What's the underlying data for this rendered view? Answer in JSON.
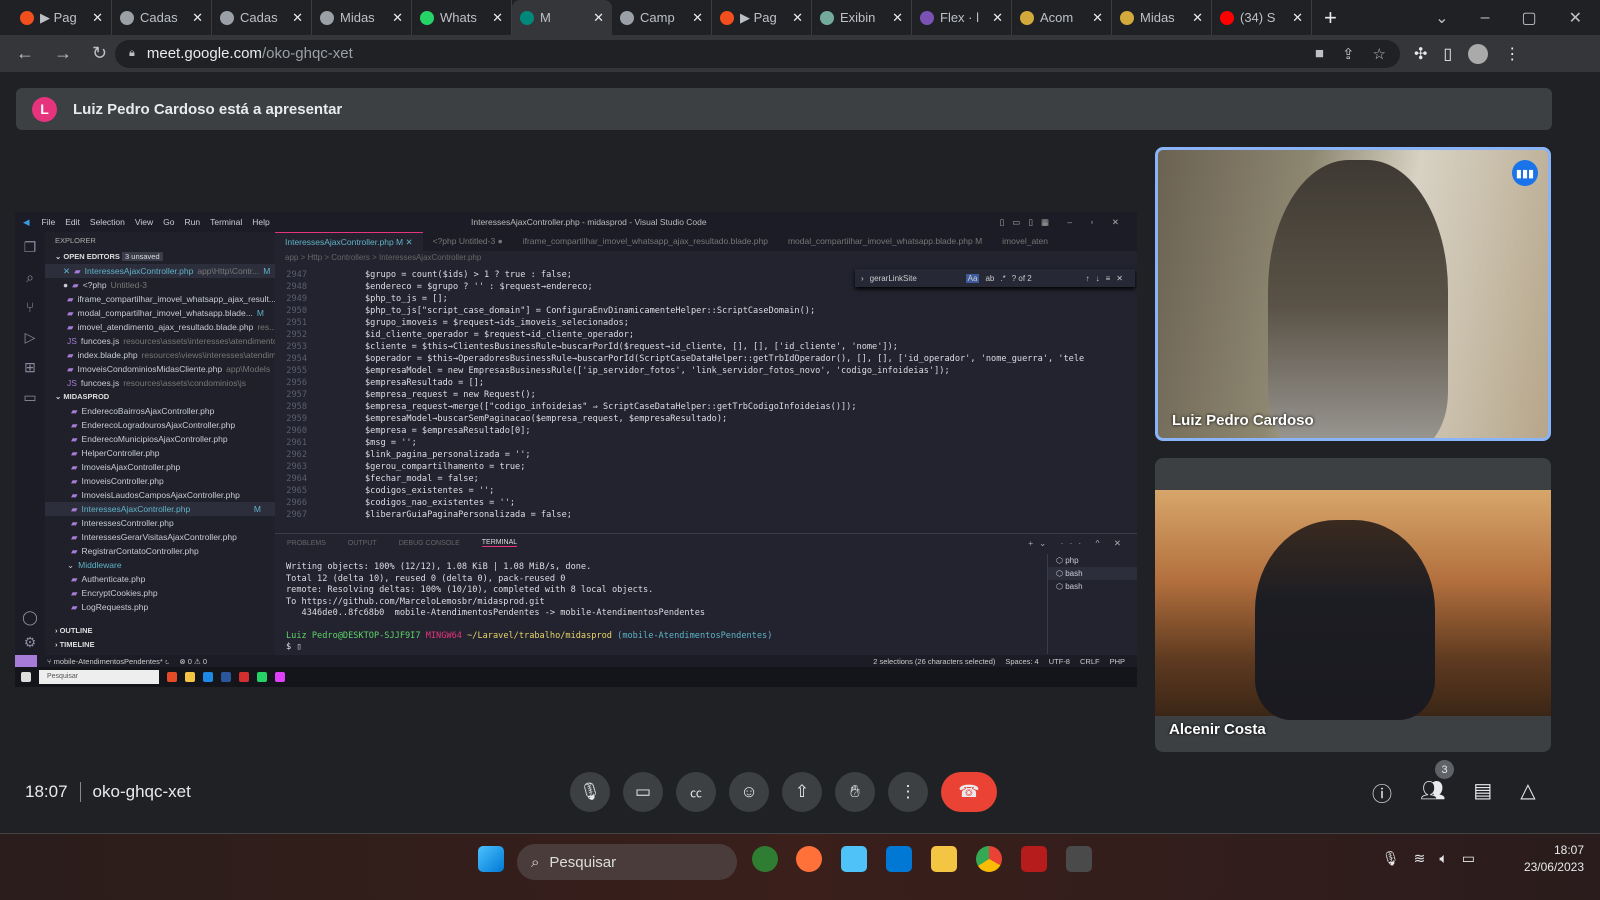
{
  "browser": {
    "tabs": [
      {
        "label": "▶ Pag",
        "color": "#f24e1e"
      },
      {
        "label": "Cadas",
        "color": "#9aa0a6"
      },
      {
        "label": "Cadas",
        "color": "#9aa0a6"
      },
      {
        "label": "Midas",
        "color": "#9aa0a6"
      },
      {
        "label": "Whats",
        "color": "#25d366"
      },
      {
        "label": "M",
        "color": "#00897b",
        "active": true
      },
      {
        "label": "Camp",
        "color": "#9aa0a6"
      },
      {
        "label": "▶ Pag",
        "color": "#f24e1e"
      },
      {
        "label": "Exibin",
        "color": "#74aa9c"
      },
      {
        "label": "Flex · l",
        "color": "#7952b3"
      },
      {
        "label": "Acom",
        "color": "#d4a93c"
      },
      {
        "label": "Midas",
        "color": "#d4a93c"
      },
      {
        "label": "(34) S",
        "color": "#ff0000"
      }
    ],
    "new_tab": "+",
    "url_domain": "meet.google.com",
    "url_path": "/oko-ghqc-xet"
  },
  "meet": {
    "banner_initial": "L",
    "banner_text": "Luiz Pedro Cardoso está a apresentar",
    "participants": [
      {
        "name": "Luiz Pedro Cardoso",
        "speaking": true
      },
      {
        "name": "Alcenir Costa"
      }
    ],
    "time": "18:07",
    "meeting_code": "oko-ghqc-xet",
    "participant_count": "3",
    "accent": "#8ab4f8",
    "end_color": "#ea4335"
  },
  "vscode": {
    "menu": [
      "File",
      "Edit",
      "Selection",
      "View",
      "Go",
      "Run",
      "Terminal",
      "Help"
    ],
    "title": "InteressesAjaxController.php - midasprod - Visual Studio Code",
    "explorer_label": "EXPLORER",
    "open_editors_label": "OPEN EDITORS",
    "unsaved": "3 unsaved",
    "open_editors": [
      {
        "name": "InteressesAjaxController.php",
        "path": "app\\Http\\Contr...",
        "mark": "M",
        "sel": true,
        "prefix": "✕"
      },
      {
        "name": "<?php",
        "path": "Untitled-3",
        "prefix": "●"
      },
      {
        "name": "iframe_compartilhar_imovel_whatsapp_ajax_result..."
      },
      {
        "name": "modal_compartilhar_imovel_whatsapp.blade...",
        "mark": "M"
      },
      {
        "name": "imovel_atendimento_ajax_resultado.blade.php",
        "path": "res..."
      },
      {
        "name": "funcoes.js",
        "path": "resources\\assets\\interesses\\atendimento\\js"
      },
      {
        "name": "index.blade.php",
        "path": "resources\\views\\interesses\\atendime..."
      },
      {
        "name": "ImoveisCondominiosMidasCliente.php",
        "path": "app\\Models"
      },
      {
        "name": "funcoes.js",
        "path": "resources\\assets\\condominios\\js"
      }
    ],
    "project_label": "MIDASPROD",
    "project_files": [
      {
        "name": "EnderecoBairrosAjaxController.php"
      },
      {
        "name": "EnderecoLogradourosAjaxController.php"
      },
      {
        "name": "EnderecoMunicipiosAjaxController.php"
      },
      {
        "name": "HelperController.php"
      },
      {
        "name": "ImoveisAjaxController.php"
      },
      {
        "name": "ImoveisController.php"
      },
      {
        "name": "ImoveisLaudosCamposAjaxController.php"
      },
      {
        "name": "InteressesAjaxController.php",
        "mark": "M",
        "sel": true
      },
      {
        "name": "InteressesController.php"
      },
      {
        "name": "InteressesGerarVisitasAjaxController.php"
      },
      {
        "name": "RegistrarContatoController.php"
      },
      {
        "name": "Middleware",
        "folder": true
      },
      {
        "name": "Authenticate.php"
      },
      {
        "name": "EncryptCookies.php"
      },
      {
        "name": "LogRequests.php"
      }
    ],
    "outline_label": "OUTLINE",
    "timeline_label": "TIMELINE",
    "editor_tabs": [
      {
        "label": "InteressesAjaxController.php M ✕",
        "active": true
      },
      {
        "label": "<?php Untitled-3 ●"
      },
      {
        "label": "iframe_compartilhar_imovel_whatsapp_ajax_resultado.blade.php"
      },
      {
        "label": "modal_compartilhar_imovel_whatsapp.blade.php M"
      },
      {
        "label": "imovel_aten"
      }
    ],
    "breadcrumb": "app > Http > Controllers > InteressesAjaxController.php",
    "find": {
      "query": "gerarLinkSite",
      "options": [
        "Aa",
        "ab",
        ".*"
      ],
      "count": "? of 2"
    },
    "code_lines": [
      {
        "n": "2947",
        "t": "$grupo = count($ids) > 1 ? true : false;"
      },
      {
        "n": "2948",
        "t": "$endereco = $grupo ? '' : $request→endereco;"
      },
      {
        "n": "2949",
        "t": "$php_to_js = [];"
      },
      {
        "n": "2950",
        "t": "$php_to_js[\"script_case_domain\"] = ConfiguraEnvDinamicamenteHelper::ScriptCaseDomain();"
      },
      {
        "n": "2951",
        "t": "$grupo_imoveis = $request→ids_imoveis_selecionados;"
      },
      {
        "n": "2952",
        "t": "$id_cliente_operador = $request→id_cliente_operador;"
      },
      {
        "n": "2953",
        "t": "$cliente = $this→ClientesBusinessRule→buscarPorId($request→id_cliente, [], [], ['id_cliente', 'nome']);"
      },
      {
        "n": "2954",
        "t": "$operador = $this→OperadoresBusinessRule→buscarPorId(ScriptCaseDataHelper::getTrbIdOperador(), [], [], ['id_operador', 'nome_guerra', 'tele"
      },
      {
        "n": "2955",
        "t": "$empresaModel = new EmpresasBusinessRule(['ip_servidor_fotos', 'link_servidor_fotos_novo', 'codigo_infoideias']);"
      },
      {
        "n": "2956",
        "t": "$empresaResultado = [];"
      },
      {
        "n": "2957",
        "t": "$empresa_request = new Request();"
      },
      {
        "n": "2958",
        "t": "$empresa_request→merge([\"codigo_infoideias\" ⇒ ScriptCaseDataHelper::getTrbCodigoInfoideias()]);"
      },
      {
        "n": "2959",
        "t": "$empresaModel→buscarSemPaginacao($empresa_request, $empresaResultado);"
      },
      {
        "n": "2960",
        "t": "$empresa = $empresaResultado[0];"
      },
      {
        "n": "2961",
        "t": "$msg = '';"
      },
      {
        "n": "2962",
        "t": "$link_pagina_personalizada = '';"
      },
      {
        "n": "2963",
        "t": "$gerou_compartilhamento = true;"
      },
      {
        "n": "2964",
        "t": "$fechar_modal = false;"
      },
      {
        "n": "2965",
        "t": "$codigos_existentes = '';"
      },
      {
        "n": "2966",
        "t": "$codigos_nao_existentes = '';"
      },
      {
        "n": "2967",
        "t": "$liberarGuiaPaginaPersonalizada = false;"
      }
    ],
    "panel_tabs": [
      "PROBLEMS",
      "OUTPUT",
      "DEBUG CONSOLE",
      "TERMINAL"
    ],
    "terminal_lines": [
      "Writing objects: 100% (12/12), 1.08 KiB | 1.08 MiB/s, done.",
      "Total 12 (delta 10), reused 0 (delta 0), pack-reused 0",
      "remote: Resolving deltas: 100% (10/10), completed with 8 local objects.",
      "To https://github.com/MarceloLemosbr/midasprod.git",
      "   4346de0..8fc68b0  mobile-AtendimentosPendentes -> mobile-AtendimentosPendentes"
    ],
    "prompt": {
      "user": "Luiz Pedro@DESKTOP-SJJF9I7",
      "env": "MINGW64",
      "path": "~/Laravel/trabalho/midasprod",
      "branch": "(mobile-AtendimentosPendentes)",
      "cursor": "$"
    },
    "terminals": [
      "php",
      "bash",
      "bash"
    ],
    "status": {
      "branch": "mobile-AtendimentosPendentes*",
      "problems": "⊗ 0 ⚠ 0",
      "selection": "2 selections (26 characters selected)",
      "spaces": "Spaces: 4",
      "encoding": "UTF-8",
      "eol": "CRLF",
      "lang": "PHP"
    },
    "inner_search": "Pesquisar"
  },
  "taskbar": {
    "search": "Pesquisar",
    "time": "18:07",
    "date": "23/06/2023"
  }
}
